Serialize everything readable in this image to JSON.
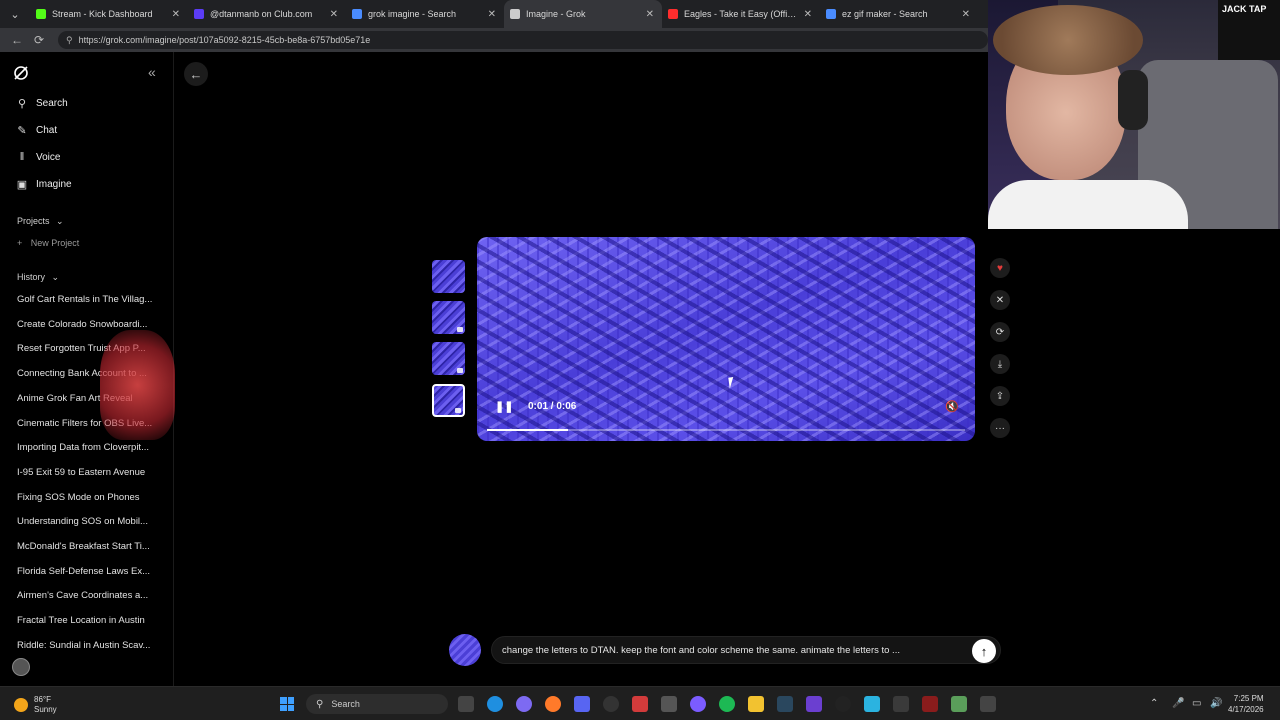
{
  "browser": {
    "tabs": [
      {
        "label": "Stream - Kick Dashboard",
        "color": "#53fc18"
      },
      {
        "label": "@dtanmanb on Club.com",
        "color": "#5b3cf5"
      },
      {
        "label": "grok imagine - Search",
        "color": "#4a8cff"
      },
      {
        "label": "Imagine - Grok",
        "color": "#cccccc"
      },
      {
        "label": "Eagles - Take it Easy (Official Audio)",
        "color": "#ff2d2d"
      },
      {
        "label": "ez gif maker - Search",
        "color": "#4a8cff"
      }
    ],
    "active_tab": 3,
    "url": "https://grok.com/imagine/post/107a5092-8215-45cb-be8a-6757bd05e71e"
  },
  "sidebar": {
    "nav": [
      {
        "label": "Search",
        "icon": "search-icon"
      },
      {
        "label": "Chat",
        "icon": "chat-icon"
      },
      {
        "label": "Voice",
        "icon": "voice-icon"
      },
      {
        "label": "Imagine",
        "icon": "image-icon"
      }
    ],
    "projects_label": "Projects",
    "new_project_label": "New Project",
    "history_label": "History",
    "history": [
      "Golf Cart Rentals in The Villag...",
      "Create Colorado Snowboardi...",
      "Reset Forgotten Truist App P...",
      "Connecting Bank Account to ...",
      "Anime Grok Fan Art Reveal",
      "Cinematic Filters for OBS Live...",
      "Importing Data from Cloverpit...",
      "I-95 Exit 59 to Eastern Avenue",
      "Fixing SOS Mode on Phones",
      "Understanding SOS on Mobil...",
      "McDonald's Breakfast Start Ti...",
      "Florida Self-Defense Laws Ex...",
      "Airmen's Cave Coordinates a...",
      "Fractal Tree Location in Austin",
      "Riddle: Sundial in Austin Scav..."
    ]
  },
  "player": {
    "play_state": "pause-icon",
    "timecode": "0:01 / 0:06",
    "progress": 0.17
  },
  "actions": [
    "heart-icon",
    "x-icon",
    "refresh-icon",
    "download-icon",
    "share-icon",
    "more-icon"
  ],
  "prompt": {
    "text": "change the letters to DTAN. keep the font and color scheme the same. animate the letters to ..."
  },
  "webcam": {
    "poster_text": "JACK TAP"
  },
  "taskbar": {
    "temp": "86°F",
    "condition": "Sunny",
    "search_label": "Search",
    "time": "7:25 PM",
    "date": "4/17/2026"
  }
}
